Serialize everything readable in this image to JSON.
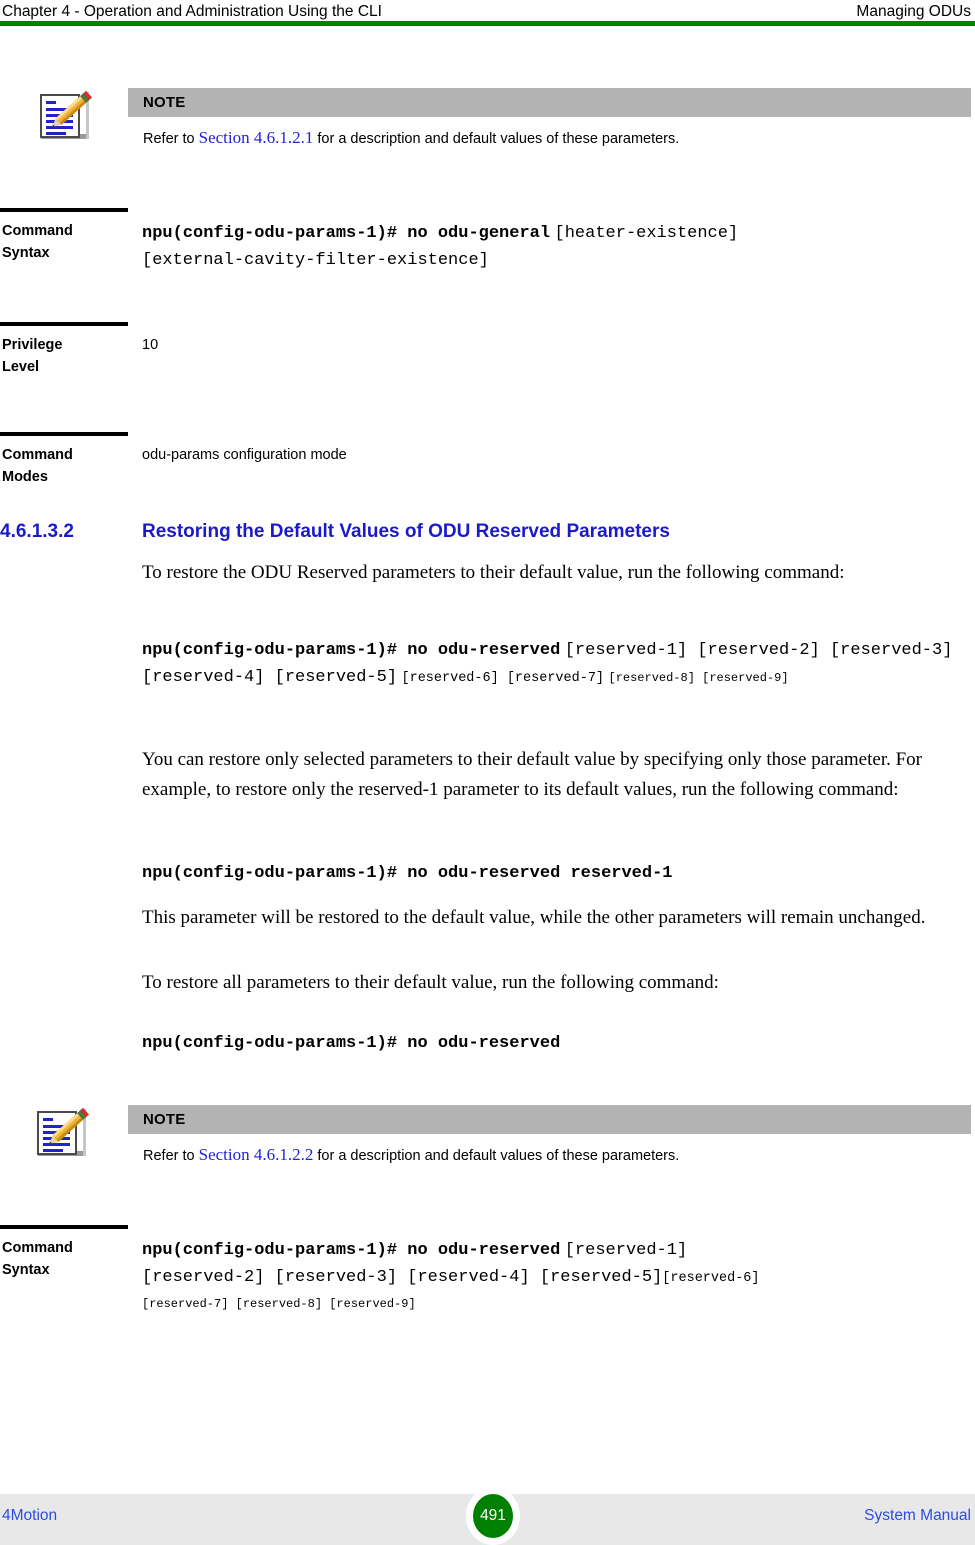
{
  "header": {
    "left": "Chapter 4 - Operation and Administration Using the CLI",
    "right": "Managing ODUs",
    "rule_color": "#008000"
  },
  "note_1": {
    "icon": "note-pencil-icon",
    "bar_label": "NOTE",
    "text_before": "Refer to ",
    "xref": "Section 4.6.1.2.1",
    "text_after": " for a description and default values of these parameters."
  },
  "spec_1": {
    "label_line1": "Command",
    "label_line2": "Syntax",
    "command_bold": "npu(config-odu-params-1)# no odu-general",
    "args_line1": "[heater-existence]",
    "args_line2": "[external-cavity-filter-existence]"
  },
  "spec_2": {
    "label_line1": "Privilege",
    "label_line2": "Level",
    "value": "10"
  },
  "spec_3": {
    "label_line1": "Command",
    "label_line2": "Modes",
    "value": "odu-params configuration mode"
  },
  "section": {
    "number": "4.6.1.3.2",
    "title": "Restoring the Default Values of ODU Reserved Parameters"
  },
  "para_1": "To restore the ODU Reserved parameters to their default value, run the following command:",
  "cmd_1": {
    "bold": "npu(config-odu-params-1)# no odu-reserved",
    "args_big": "[reserved-1] [reserved-2] [reserved-3] [reserved-4] [reserved-5]",
    "args_mid": "[reserved-6] [reserved-7]",
    "args_small": "[reserved-8] [reserved-9]"
  },
  "para_2": "You can restore only selected parameters to their default value by specifying only those parameter. For example, to restore only the reserved-1 parameter to its default values, run the following command:",
  "cmd_2": {
    "bold": "npu(config-odu-params-1)# no odu-reserved reserved-1"
  },
  "para_3": "This parameter will be restored to the default value, while the other parameters will remain unchanged.",
  "para_4": "To restore all parameters to their default value, run the following command:",
  "cmd_3": {
    "bold": "npu(config-odu-params-1)# no odu-reserved"
  },
  "note_2": {
    "icon": "note-pencil-icon",
    "bar_label": "NOTE",
    "text_before": "Refer to ",
    "xref": "Section 4.6.1.2.2",
    "text_after": " for a description and default values of these parameters."
  },
  "spec_4": {
    "label_line1": "Command",
    "label_line2": "Syntax",
    "command_bold": "npu(config-odu-params-1)# no odu-reserved",
    "args_line1": "[reserved-1]",
    "args_line2": "[reserved-2] [reserved-3] [reserved-4] [reserved-5]",
    "args_line2b": "[reserved-6]",
    "args_line3": "[reserved-7] [reserved-8] [reserved-9]"
  },
  "footer": {
    "left": "4Motion",
    "page_number": "491",
    "right": "System Manual",
    "page_badge_color": "#008000",
    "link_color": "#2b4de0"
  }
}
